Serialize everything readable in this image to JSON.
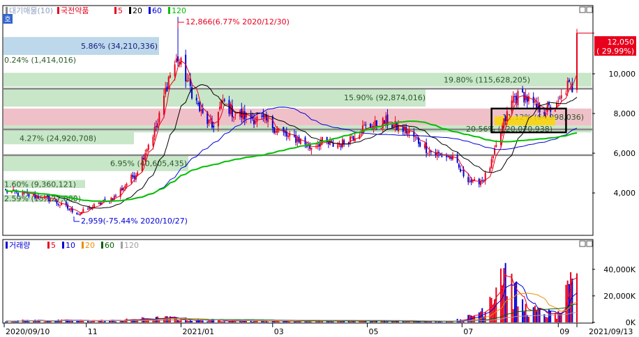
{
  "price_panel": {
    "legend": {
      "label_prefix": "대기매물(10)",
      "title": "국전약품",
      "ma_labels": [
        "5",
        "20",
        "60",
        "120"
      ],
      "ma_colors": [
        "#e8001c",
        "#000000",
        "#0000d8",
        "#00c000"
      ]
    },
    "badge": "호",
    "last_price": {
      "value": "12,050",
      "change": "( 29.99%)"
    },
    "high_annotation": "12,866(6.77% 2020/12/30)",
    "low_annotation": "2,959(-75.44% 2020/10/27)"
  },
  "volume_panel": {
    "legend": {
      "title": "거래량",
      "ma_labels": [
        "5",
        "10",
        "20",
        "60",
        "120"
      ],
      "ma_colors": [
        "#e8001c",
        "#0000d8",
        "#e89000",
        "#006000",
        "#a0a0a0"
      ]
    }
  },
  "x_axis": {
    "labels": [
      "2020/09/10",
      "11",
      "2021/01",
      "03",
      "05",
      "07",
      "09",
      "2021/09/13"
    ]
  },
  "colors": {
    "up": "#e8001c",
    "down": "#0000d8",
    "zone_green": "#c8e6c8",
    "zone_blue": "#bcd8ea",
    "zone_red": "#f0c0c8",
    "zone_yellow": "#f8d800"
  },
  "chart_data": {
    "type": "candlestick",
    "price_axis": {
      "ticks": [
        "4,000",
        "6,000",
        "8,000",
        "10,000"
      ],
      "ylim": [
        1900,
        13400
      ]
    },
    "volume_axis": {
      "ticks": [
        "0K",
        "20,000K",
        "40,000K"
      ],
      "ylim": [
        0,
        53000
      ]
    },
    "supply_zones": [
      {
        "label": "5.86% (34,210,336)",
        "low": 10950,
        "high": 11850,
        "kind": "blue"
      },
      {
        "label": "0.24% (1,414,016)",
        "low": 10450,
        "high": 10950,
        "kind": "none"
      },
      {
        "label": "19.80% (115,628,205)",
        "low": 9350,
        "high": 10050,
        "kind": "green"
      },
      {
        "label": "15.90% (92,874,016)",
        "low": 8350,
        "high": 9250,
        "kind": "green"
      },
      {
        "label": "11.12% (64,998,036)",
        "low": 7400,
        "high": 8250,
        "kind": "red"
      },
      {
        "label": "20.56% (120,070,938)",
        "low": 7050,
        "high": 7400,
        "kind": "green"
      },
      {
        "label": "4.27% (24,920,708)",
        "low": 6450,
        "high": 7050,
        "kind": "green"
      },
      {
        "label": "6.95% (40,605,435)",
        "low": 5100,
        "high": 5900,
        "kind": "green"
      },
      {
        "label": "1.60% (9,360,121)",
        "low": 4250,
        "high": 4650,
        "kind": "green"
      },
      {
        "label": "2.59% (15,127,000)",
        "low": 3550,
        "high": 3900,
        "kind": "green"
      }
    ],
    "levels": [
      9250,
      7200,
      5900
    ],
    "anchors": [
      [
        "2020-09-10",
        4100
      ],
      [
        "2020-09-24",
        3900
      ],
      [
        "2020-10-08",
        3700
      ],
      [
        "2020-10-27",
        2959
      ],
      [
        "2020-11-05",
        3300
      ],
      [
        "2020-11-19",
        3800
      ],
      [
        "2020-12-03",
        5000
      ],
      [
        "2020-12-10",
        6300
      ],
      [
        "2020-12-17",
        7500
      ],
      [
        "2020-12-24",
        9800
      ],
      [
        "2020-12-30",
        10800
      ],
      [
        "2021-01-07",
        9300
      ],
      [
        "2021-01-14",
        8000
      ],
      [
        "2021-01-21",
        7300
      ],
      [
        "2021-01-28",
        8600
      ],
      [
        "2021-02-04",
        8000
      ],
      [
        "2021-02-15",
        7800
      ],
      [
        "2021-02-25",
        7600
      ],
      [
        "2021-03-04",
        7200
      ],
      [
        "2021-03-11",
        6800
      ],
      [
        "2021-03-18",
        6700
      ],
      [
        "2021-03-25",
        6300
      ],
      [
        "2021-04-01",
        6600
      ],
      [
        "2021-04-08",
        6400
      ],
      [
        "2021-04-15",
        6500
      ],
      [
        "2021-04-22",
        6900
      ],
      [
        "2021-04-29",
        7300
      ],
      [
        "2021-05-06",
        7400
      ],
      [
        "2021-05-13",
        7600
      ],
      [
        "2021-05-20",
        7300
      ],
      [
        "2021-05-27",
        7100
      ],
      [
        "2021-06-03",
        6600
      ],
      [
        "2021-06-10",
        6100
      ],
      [
        "2021-06-17",
        5900
      ],
      [
        "2021-06-24",
        5800
      ],
      [
        "2021-07-01",
        5000
      ],
      [
        "2021-07-08",
        4500
      ],
      [
        "2021-07-15",
        4700
      ],
      [
        "2021-07-20",
        5500
      ],
      [
        "2021-07-27",
        7300
      ],
      [
        "2021-08-03",
        8800
      ],
      [
        "2021-08-10",
        8900
      ],
      [
        "2021-08-17",
        8300
      ],
      [
        "2021-08-24",
        8200
      ],
      [
        "2021-08-31",
        8300
      ],
      [
        "2021-09-07",
        9400
      ],
      [
        "2021-09-10",
        9270
      ],
      [
        "2021-09-13",
        12050
      ]
    ],
    "volume_profile": [
      [
        "2020-09-10",
        1500
      ],
      [
        "2020-11-20",
        1500
      ],
      [
        "2020-12-10",
        3000
      ],
      [
        "2020-12-24",
        3500
      ],
      [
        "2021-01-10",
        2000
      ],
      [
        "2021-03-01",
        1200
      ],
      [
        "2021-06-25",
        1000
      ],
      [
        "2021-07-08",
        5000
      ],
      [
        "2021-07-15",
        12000
      ],
      [
        "2021-07-22",
        30000
      ],
      [
        "2021-07-27",
        50000
      ],
      [
        "2021-08-03",
        25000
      ],
      [
        "2021-08-10",
        12000
      ],
      [
        "2021-08-20",
        8000
      ],
      [
        "2021-09-01",
        6000
      ],
      [
        "2021-09-08",
        25000
      ],
      [
        "2021-09-13",
        33000
      ]
    ]
  }
}
